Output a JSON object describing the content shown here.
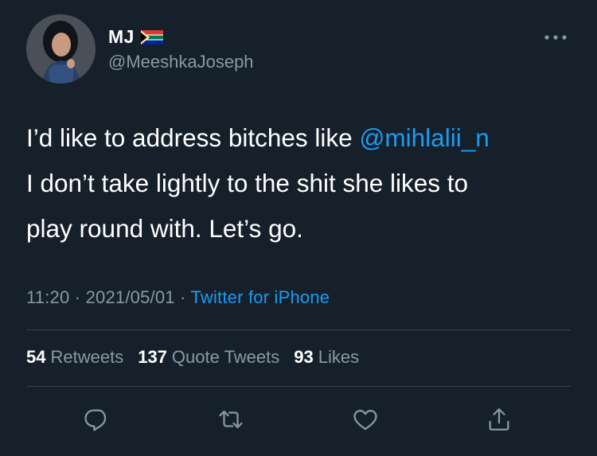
{
  "colors": {
    "background": "#15202b",
    "text_primary": "#ffffff",
    "text_secondary": "#8899a6",
    "accent": "#1d9bf0",
    "divider": "#38444d"
  },
  "author": {
    "display_name": "MJ",
    "flag_icon": "south-africa-flag-icon",
    "handle": "@MeeshkaJoseph",
    "avatar_icon": "profile-photo"
  },
  "tweet": {
    "text_before": "I’d like to address bitches like ",
    "mention": "@mihlalii_n",
    "text_after": "\nI don’t take lightly to the shit she likes to\nplay round with. Let’s go."
  },
  "meta": {
    "time": "11:20",
    "separator": " · ",
    "date": "2021/05/01",
    "source": "Twitter for iPhone"
  },
  "stats": {
    "retweets_count": "54",
    "retweets_label": "Retweets",
    "quote_count": "137",
    "quote_label": "Quote Tweets",
    "likes_count": "93",
    "likes_label": "Likes"
  },
  "actions": {
    "reply_icon": "reply-icon",
    "retweet_icon": "retweet-icon",
    "like_icon": "heart-icon",
    "share_icon": "share-icon",
    "more_icon": "more-options-icon"
  }
}
